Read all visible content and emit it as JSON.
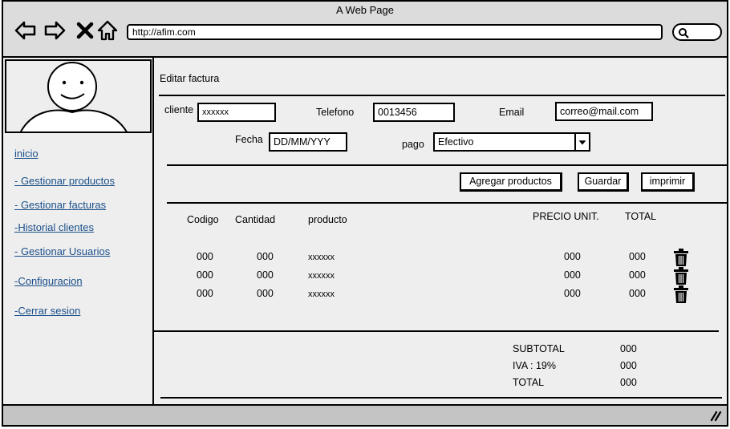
{
  "window": {
    "title": "A Web Page",
    "url": "http://afim.com"
  },
  "sidebar": {
    "items": [
      {
        "label": "inicio "
      },
      {
        "label": "- Gestionar productos"
      },
      {
        "label": "- Gestionar facturas"
      },
      {
        "label": "-Historial clientes"
      },
      {
        "label": "- Gestionar Usuarios"
      },
      {
        "label": "-Configuracion "
      },
      {
        "label": "-Cerrar sesion"
      }
    ]
  },
  "main": {
    "heading": "Editar factura",
    "form": {
      "cliente_label": "cliente",
      "cliente_value": "xxxxxx",
      "telefono_label": "Telefono",
      "telefono_value": "0013456",
      "email_label": "Email",
      "email_value": "correo@mail.com",
      "fecha_label": "Fecha",
      "fecha_value": "DD/MM/YYY",
      "pago_label": "pago",
      "pago_value": "Efectivo"
    },
    "actions": {
      "agregar": "Agregar productos",
      "guardar": "Guardar",
      "imprimir": "imprimir"
    },
    "table": {
      "headers": {
        "codigo": "Codigo",
        "cantidad": "Cantidad",
        "producto": "producto",
        "precio": "PRECIO UNIT.",
        "total": "TOTAL"
      },
      "rows": [
        {
          "codigo": "000",
          "cantidad": "000",
          "producto": "xxxxxx",
          "precio": "000",
          "total": "000"
        },
        {
          "codigo": "000",
          "cantidad": "000",
          "producto": "xxxxxx",
          "precio": "000",
          "total": "000"
        },
        {
          "codigo": "000",
          "cantidad": "000",
          "producto": "xxxxxx",
          "precio": "000",
          "total": "000"
        }
      ]
    },
    "totals": {
      "subtotal_label": "SUBTOTAL",
      "subtotal_value": "000",
      "iva_label": "IVA : 19%",
      "iva_value": "000",
      "total_label": "TOTAL",
      "total_value": "000"
    }
  },
  "icons": [
    "back-icon",
    "forward-icon",
    "close-icon",
    "home-icon",
    "search-icon",
    "trash-icon",
    "resize-icon"
  ]
}
